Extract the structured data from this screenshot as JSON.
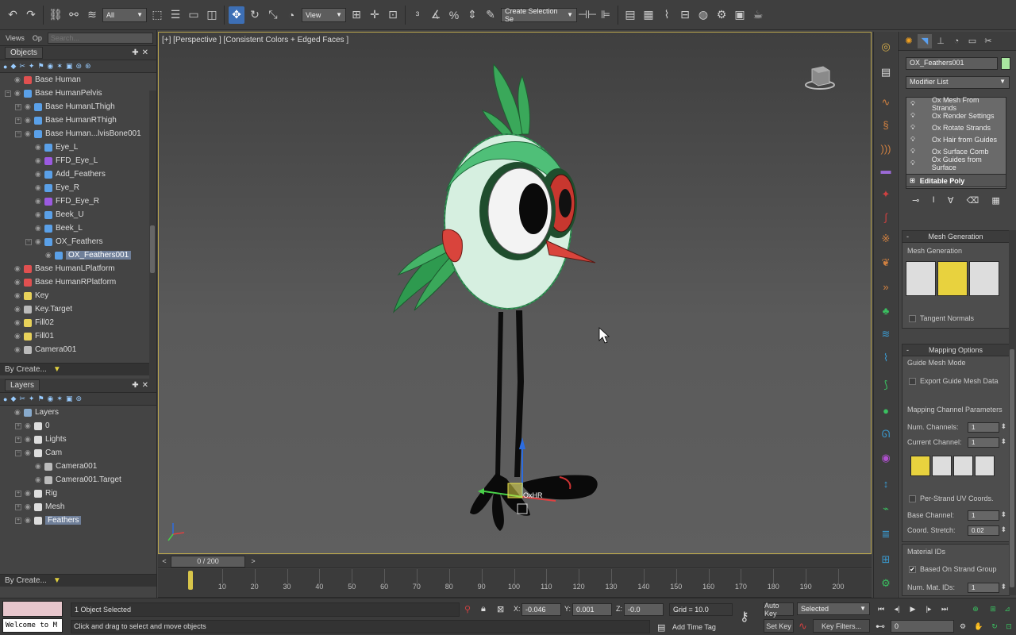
{
  "toolbar": {
    "selection_filter": "All",
    "ref_coord": "View",
    "named_selection": "Create Selection Se"
  },
  "explorer": {
    "views_label": "Views",
    "op_label": "Op",
    "search_placeholder": "Search...",
    "objects_tab": "Objects",
    "objects": [
      {
        "label": "Base Human",
        "indent": 0,
        "exp": "",
        "kind": "bone-red"
      },
      {
        "label": "Base HumanPelvis",
        "indent": 0,
        "exp": "-",
        "kind": "bone-blue"
      },
      {
        "label": "Base HumanLThigh",
        "indent": 1,
        "exp": "+",
        "kind": "bone-blue"
      },
      {
        "label": "Base HumanRThigh",
        "indent": 1,
        "exp": "+",
        "kind": "bone-blue"
      },
      {
        "label": "Base Human...lvisBone001",
        "indent": 1,
        "exp": "-",
        "kind": "bone-blue"
      },
      {
        "label": "Eye_L",
        "indent": 2,
        "exp": "",
        "kind": "bone-blue"
      },
      {
        "label": "FFD_Eye_L",
        "indent": 2,
        "exp": "",
        "kind": "ffd-purple"
      },
      {
        "label": "Add_Feathers",
        "indent": 2,
        "exp": "",
        "kind": "bone-blue"
      },
      {
        "label": "Eye_R",
        "indent": 2,
        "exp": "",
        "kind": "bone-blue"
      },
      {
        "label": "FFD_Eye_R",
        "indent": 2,
        "exp": "",
        "kind": "ffd-purple"
      },
      {
        "label": "Beek_U",
        "indent": 2,
        "exp": "",
        "kind": "bone-blue"
      },
      {
        "label": "Beek_L",
        "indent": 2,
        "exp": "",
        "kind": "bone-blue"
      },
      {
        "label": "OX_Feathers",
        "indent": 2,
        "exp": "-",
        "kind": "bone-blue"
      },
      {
        "label": "OX_Feathers001",
        "indent": 3,
        "exp": "",
        "kind": "bone-blue",
        "selected": true
      },
      {
        "label": "Base HumanLPlatform",
        "indent": 0,
        "exp": "",
        "kind": "bone-red"
      },
      {
        "label": "Base HumanRPlatform",
        "indent": 0,
        "exp": "",
        "kind": "bone-red"
      },
      {
        "label": "Key",
        "indent": 0,
        "exp": "",
        "kind": "light"
      },
      {
        "label": "Key.Target",
        "indent": 0,
        "exp": "",
        "kind": "target"
      },
      {
        "label": "Fill02",
        "indent": 0,
        "exp": "",
        "kind": "light"
      },
      {
        "label": "Fill01",
        "indent": 0,
        "exp": "",
        "kind": "light"
      },
      {
        "label": "Camera001",
        "indent": 0,
        "exp": "",
        "kind": "camera"
      }
    ],
    "by_create_top": "By Create...",
    "layers_tab": "Layers",
    "layers": [
      {
        "label": "Layers",
        "indent": 0,
        "exp": "",
        "kind": "layers-root"
      },
      {
        "label": "0",
        "indent": 1,
        "exp": "+",
        "kind": "layer"
      },
      {
        "label": "Lights",
        "indent": 1,
        "exp": "+",
        "kind": "layer"
      },
      {
        "label": "Cam",
        "indent": 1,
        "exp": "-",
        "kind": "layer"
      },
      {
        "label": "Camera001",
        "indent": 2,
        "exp": "",
        "kind": "camera"
      },
      {
        "label": "Camera001.Target",
        "indent": 2,
        "exp": "",
        "kind": "target"
      },
      {
        "label": "Rig",
        "indent": 1,
        "exp": "+",
        "kind": "layer"
      },
      {
        "label": "Mesh",
        "indent": 1,
        "exp": "+",
        "kind": "layer"
      },
      {
        "label": "Feathers",
        "indent": 1,
        "exp": "+",
        "kind": "layer-active",
        "selected": true
      }
    ],
    "by_create_bottom": "By Create..."
  },
  "viewport": {
    "label": "[+] [Perspective ] [Consistent Colors + Edged Faces ]",
    "gizmo_label": "OxHR"
  },
  "timeline": {
    "slider": "0 / 200",
    "ticks": [
      "10",
      "20",
      "30",
      "40",
      "50",
      "60",
      "70",
      "80",
      "90",
      "100",
      "110",
      "120",
      "130",
      "140",
      "150",
      "160",
      "170",
      "180",
      "190",
      "200"
    ]
  },
  "command_panel": {
    "object_name": "OX_Feathers001",
    "object_color": "#a9e6a0",
    "modifier_list": "Modifier List",
    "stack": [
      "Ox Mesh From Strands",
      "Ox Render Settings",
      "Ox Rotate Strands",
      "Ox Hair from Guides",
      "Ox Surface Comb",
      "Ox Guides from Surface"
    ],
    "base_object": "Editable Poly",
    "mesh_generation": {
      "header": "Mesh Generation",
      "subheader": "Mesh Generation",
      "tangent_normals": "Tangent Normals"
    },
    "mapping": {
      "header": "Mapping Options",
      "guide_mesh_mode": "Guide Mesh Mode",
      "export_guide": "Export Guide Mesh Data",
      "channel_params": "Mapping Channel Parameters",
      "num_channels_label": "Num. Channels:",
      "num_channels": "1",
      "current_channel_label": "Current Channel:",
      "current_channel": "1",
      "per_strand": "Per-Strand UV Coords.",
      "base_channel_label": "Base Channel:",
      "base_channel": "1",
      "coord_stretch_label": "Coord. Stretch:",
      "coord_stretch": "0.02"
    },
    "material": {
      "header": "Material IDs",
      "based_on": "Based On Strand Group",
      "num_mat_label": "Num. Mat. IDs:",
      "num_mat": "1"
    }
  },
  "status": {
    "welcome": "Welcome to M",
    "selected": "1 Object Selected",
    "prompt": "Click and drag to select and move objects",
    "x_label": "X:",
    "x": "-0.046",
    "y_label": "Y:",
    "y": "0.001",
    "z_label": "Z:",
    "z": "-0.0",
    "grid": "Grid = 10.0",
    "add_time_tag": "Add Time Tag",
    "auto_key": "Auto Key",
    "key_mode": "Selected",
    "set_key": "Set Key",
    "key_filters": "Key Filters...",
    "frame": "0"
  }
}
